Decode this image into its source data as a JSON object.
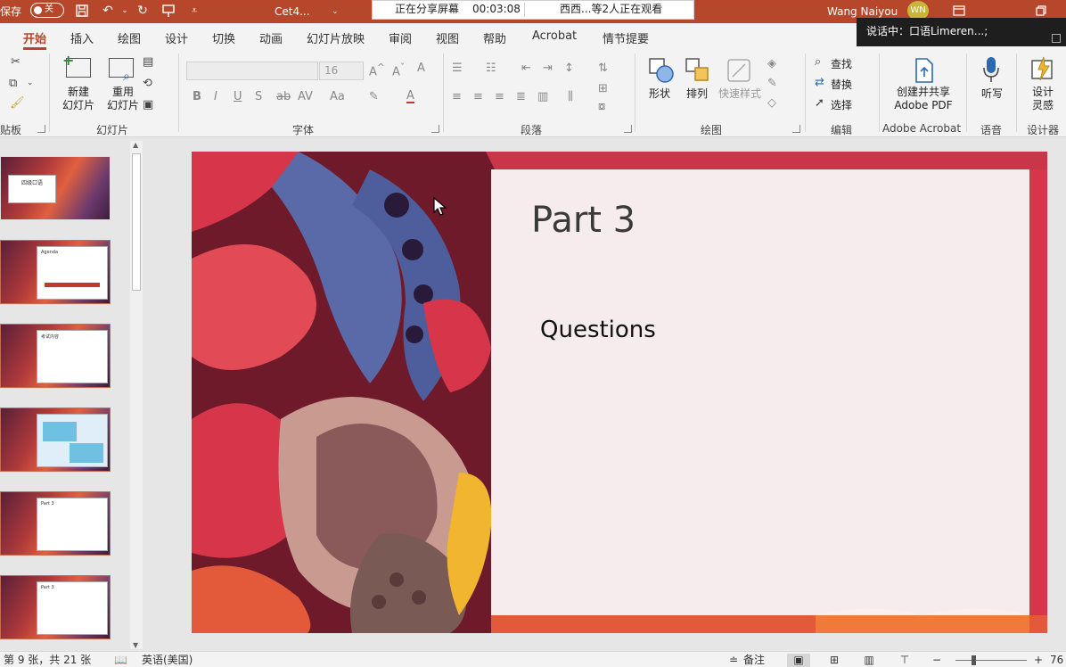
{
  "titlebar": {
    "autosave_label": "保存",
    "autosave_state": "关",
    "file_name": "Cet4...",
    "share_status": "正在分享屏幕",
    "share_time": "00:03:08",
    "viewers": "西西...等2人正在观看",
    "user_name": "Wang Naiyou",
    "user_initials": "WN",
    "speaking": "说话中：口语Limeren...;"
  },
  "tabs": [
    "开始",
    "插入",
    "绘图",
    "设计",
    "切换",
    "动画",
    "幻灯片放映",
    "审阅",
    "视图",
    "帮助",
    "Acrobat",
    "情节提要"
  ],
  "ribbon": {
    "clipboard_label": "贴板",
    "slides_group": "幻灯片",
    "new_slide": [
      "新建",
      "幻灯片"
    ],
    "reuse_slide": [
      "重用",
      "幻灯片"
    ],
    "font_group": "字体",
    "font_size": "16",
    "paragraph_group": "段落",
    "drawing_group": "绘图",
    "shape": "形状",
    "arrange": "排列",
    "quick_styles": "快速样式",
    "editing_group": "编辑",
    "find": "查找",
    "replace": "替换",
    "select": "选择",
    "adobe_group": "Adobe Acrobat",
    "create_share": [
      "创建并共享",
      "Adobe PDF"
    ],
    "voice_group": "语音",
    "dictate": "听写",
    "designer_group": "设计器",
    "design_ideas": [
      "设计",
      "灵感"
    ]
  },
  "thumbnails": [
    {
      "title": "四级口语"
    },
    {
      "title": "Agenda"
    },
    {
      "title": "考试内容"
    },
    {
      "title": ""
    },
    {
      "title": "Part 3"
    },
    {
      "title": "Part 3"
    }
  ],
  "slide": {
    "title": "Part 3",
    "body": "Questions"
  },
  "status": {
    "slide_count": "第 9 张，共 21 张",
    "language": "英语(美国)",
    "notes": "备注",
    "zoom": "76"
  }
}
